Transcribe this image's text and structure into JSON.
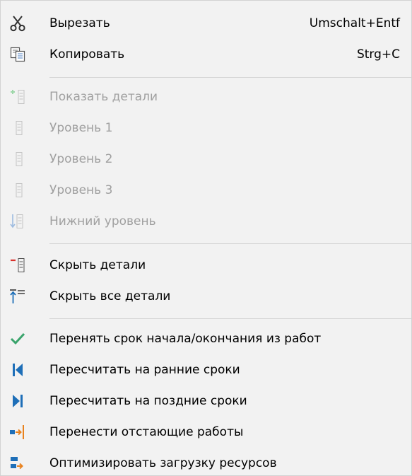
{
  "menu": {
    "items": [
      {
        "label": "Вырезать",
        "shortcut": "Umschalt+Entf",
        "icon": "scissors-icon",
        "enabled": true
      },
      {
        "label": "Копировать",
        "shortcut": "Strg+C",
        "icon": "copy-icon",
        "enabled": true
      },
      {
        "label": "Показать детали",
        "icon": "show-details-icon",
        "enabled": false
      },
      {
        "label": "Уровень 1",
        "icon": "outline-level-icon",
        "enabled": false
      },
      {
        "label": "Уровень 2",
        "icon": "outline-level-icon",
        "enabled": false
      },
      {
        "label": "Уровень 3",
        "icon": "outline-level-icon",
        "enabled": false
      },
      {
        "label": "Нижний уровень",
        "icon": "bottom-level-icon",
        "enabled": false
      },
      {
        "label": "Скрыть детали",
        "icon": "hide-details-icon",
        "enabled": true
      },
      {
        "label": "Скрыть все детали",
        "icon": "hide-all-details-icon",
        "enabled": true
      },
      {
        "label": "Перенять срок начала/окончания из работ",
        "icon": "checkmark-icon",
        "enabled": true
      },
      {
        "label": "Пересчитать на ранние сроки",
        "icon": "skip-back-icon",
        "enabled": true
      },
      {
        "label": "Пересчитать на поздние сроки",
        "icon": "skip-forward-icon",
        "enabled": true
      },
      {
        "label": "Перенести отстающие работы",
        "icon": "move-lagging-tasks-icon",
        "enabled": true
      },
      {
        "label": "Оптимизировать загрузку ресурсов",
        "icon": "optimize-resources-icon",
        "enabled": true
      }
    ]
  },
  "colors": {
    "background": "#f2f2f2",
    "disabled_text": "#a0a0a0",
    "accent_blue": "#1e6fb8",
    "accent_red": "#d9312b",
    "accent_green": "#3aa46c",
    "accent_orange": "#e8821e"
  }
}
